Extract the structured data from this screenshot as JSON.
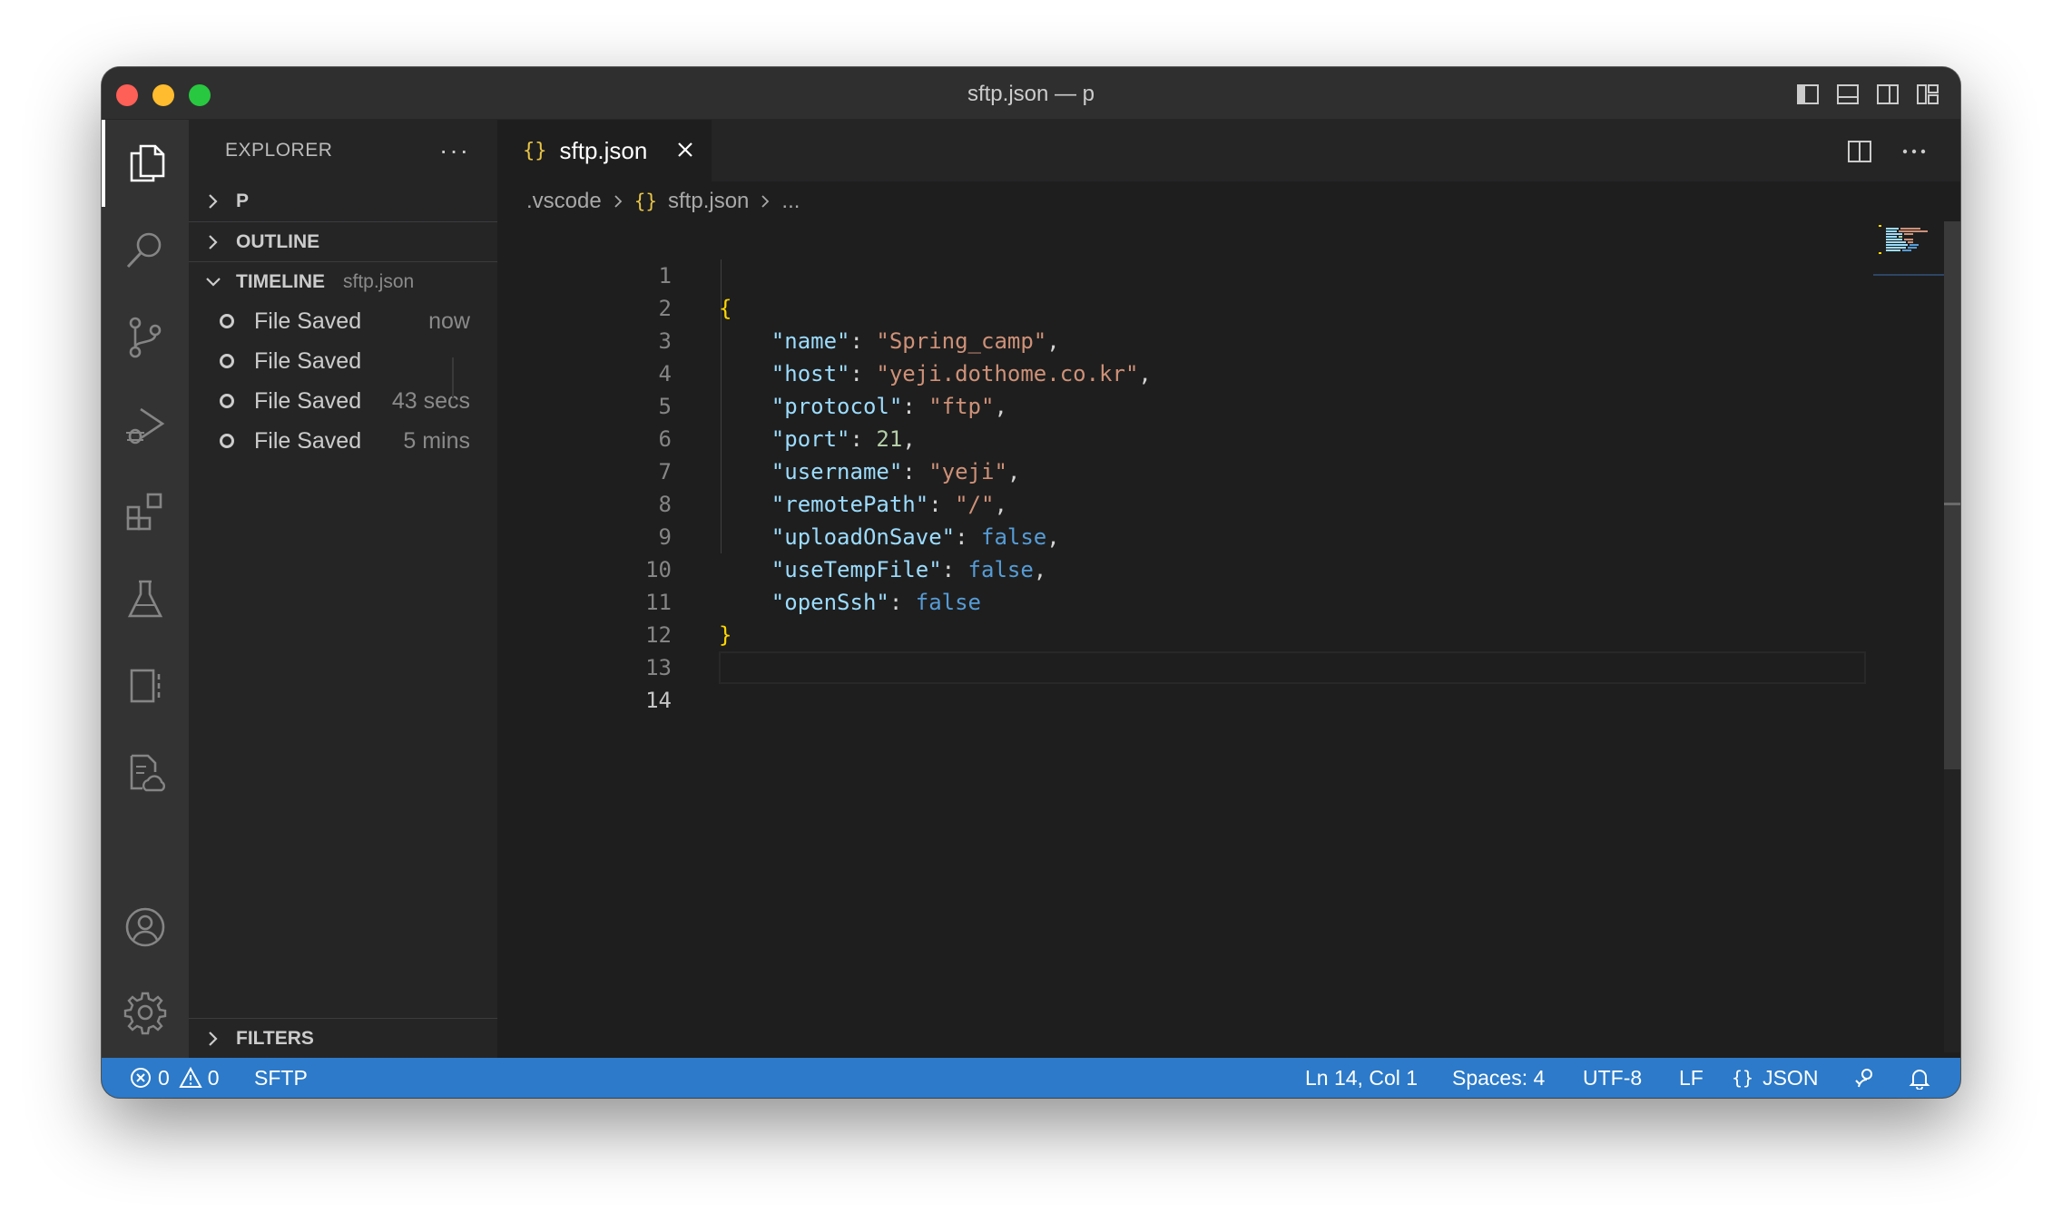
{
  "window": {
    "title": "sftp.json — p"
  },
  "sidebar": {
    "header": "EXPLORER",
    "more": "···",
    "sections": {
      "folder": "P",
      "outline": "OUTLINE",
      "timeline": "TIMELINE",
      "timeline_file": "sftp.json",
      "filters": "FILTERS"
    },
    "timeline_items": [
      {
        "label": "File Saved",
        "time": "now"
      },
      {
        "label": "File Saved",
        "time": ""
      },
      {
        "label": "File Saved",
        "time": "43 secs"
      },
      {
        "label": "File Saved",
        "time": "5 mins"
      }
    ]
  },
  "editor": {
    "tab": {
      "icon": "{}",
      "label": "sftp.json"
    },
    "breadcrumb": {
      "folder": ".vscode",
      "icon": "{}",
      "file": "sftp.json",
      "more": "..."
    },
    "lines": [
      {
        "n": "1"
      },
      {
        "n": "2"
      },
      {
        "n": "3"
      },
      {
        "n": "4"
      },
      {
        "n": "5"
      },
      {
        "n": "6"
      },
      {
        "n": "7"
      },
      {
        "n": "8"
      },
      {
        "n": "9"
      },
      {
        "n": "10"
      },
      {
        "n": "11"
      },
      {
        "n": "12"
      },
      {
        "n": "13"
      },
      {
        "n": "14"
      }
    ],
    "code": {
      "open": "{",
      "close": "}",
      "k1": "\"name\"",
      "v1": "\"Spring_camp\"",
      "k2": "\"host\"",
      "v2": "\"yeji.dothome.co.kr\"",
      "k3": "\"protocol\"",
      "v3": "\"ftp\"",
      "k4": "\"port\"",
      "v4": "21",
      "k5": "\"username\"",
      "v5": "\"yeji\"",
      "k6": "\"remotePath\"",
      "v6": "\"/\"",
      "k7": "\"uploadOnSave\"",
      "v7": "false",
      "k8": "\"useTempFile\"",
      "v8": "false",
      "k9": "\"openSsh\"",
      "v9": "false"
    }
  },
  "statusbar": {
    "errors": "0",
    "warnings": "0",
    "sftp": "SFTP",
    "position": "Ln 14, Col 1",
    "spaces": "Spaces: 4",
    "encoding": "UTF-8",
    "eol": "LF",
    "lang_icon": "{}",
    "language": "JSON"
  },
  "colors": {
    "statusbar": "#2c7ac9",
    "activitybar": "#333333",
    "sidebar": "#252526",
    "editor": "#1e1e1e"
  }
}
